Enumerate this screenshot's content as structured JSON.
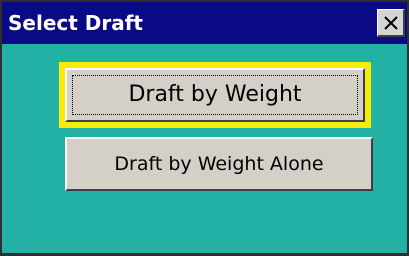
{
  "dialog": {
    "title": "Select Draft",
    "close_glyph": "×",
    "close_icon": "close-icon",
    "buttons": [
      {
        "label": "Draft by Weight",
        "focused": true
      },
      {
        "label": "Draft by Weight Alone",
        "focused": false
      }
    ]
  },
  "colors": {
    "titlebar": "#0a0a84",
    "background": "#23b1a6",
    "focus_highlight": "#f7ec07",
    "button_face": "#d4d0c8"
  }
}
